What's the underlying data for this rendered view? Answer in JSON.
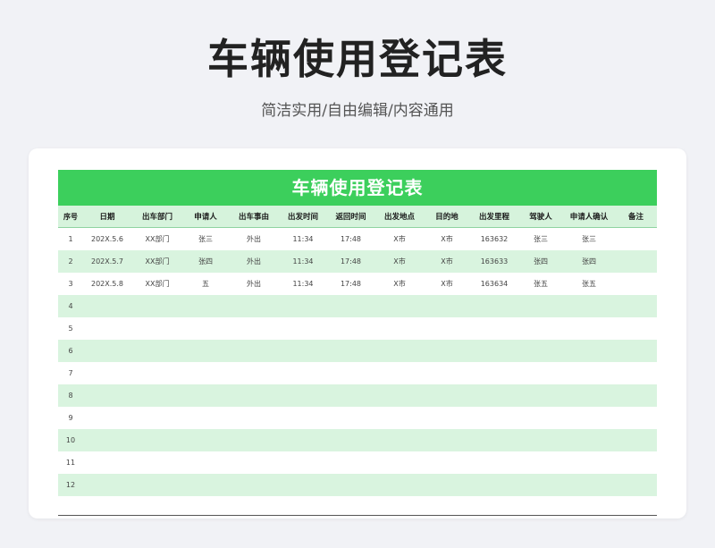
{
  "page": {
    "title": "车辆使用登记表",
    "subtitle": "简洁实用/自由编辑/内容通用"
  },
  "sheet": {
    "banner": "车辆使用登记表",
    "columns": [
      "序号",
      "日期",
      "出车部门",
      "申请人",
      "出车事由",
      "出发时间",
      "返回时间",
      "出发地点",
      "目的地",
      "出发里程",
      "驾驶人",
      "申请人确认",
      "备注"
    ],
    "rows": [
      [
        "1",
        "202X.5.6",
        "XX部门",
        "张三",
        "外出",
        "11:34",
        "17:48",
        "X市",
        "X市",
        "163632",
        "张三",
        "张三",
        ""
      ],
      [
        "2",
        "202X.5.7",
        "XX部门",
        "张四",
        "外出",
        "11:34",
        "17:48",
        "X市",
        "X市",
        "163633",
        "张四",
        "张四",
        ""
      ],
      [
        "3",
        "202X.5.8",
        "XX部门",
        "五",
        "外出",
        "11:34",
        "17:48",
        "X市",
        "X市",
        "163634",
        "张五",
        "张五",
        ""
      ],
      [
        "4",
        "",
        "",
        "",
        "",
        "",
        "",
        "",
        "",
        "",
        "",
        "",
        ""
      ],
      [
        "5",
        "",
        "",
        "",
        "",
        "",
        "",
        "",
        "",
        "",
        "",
        "",
        ""
      ],
      [
        "6",
        "",
        "",
        "",
        "",
        "",
        "",
        "",
        "",
        "",
        "",
        "",
        ""
      ],
      [
        "7",
        "",
        "",
        "",
        "",
        "",
        "",
        "",
        "",
        "",
        "",
        "",
        ""
      ],
      [
        "8",
        "",
        "",
        "",
        "",
        "",
        "",
        "",
        "",
        "",
        "",
        "",
        ""
      ],
      [
        "9",
        "",
        "",
        "",
        "",
        "",
        "",
        "",
        "",
        "",
        "",
        "",
        ""
      ],
      [
        "10",
        "",
        "",
        "",
        "",
        "",
        "",
        "",
        "",
        "",
        "",
        "",
        ""
      ],
      [
        "11",
        "",
        "",
        "",
        "",
        "",
        "",
        "",
        "",
        "",
        "",
        "",
        ""
      ],
      [
        "12",
        "",
        "",
        "",
        "",
        "",
        "",
        "",
        "",
        "",
        "",
        "",
        ""
      ]
    ]
  },
  "colors": {
    "accent": "#3ccf5c",
    "header_bg": "#d6f3dc",
    "stripe": "#d9f4df",
    "background": "#f1f2f6"
  }
}
